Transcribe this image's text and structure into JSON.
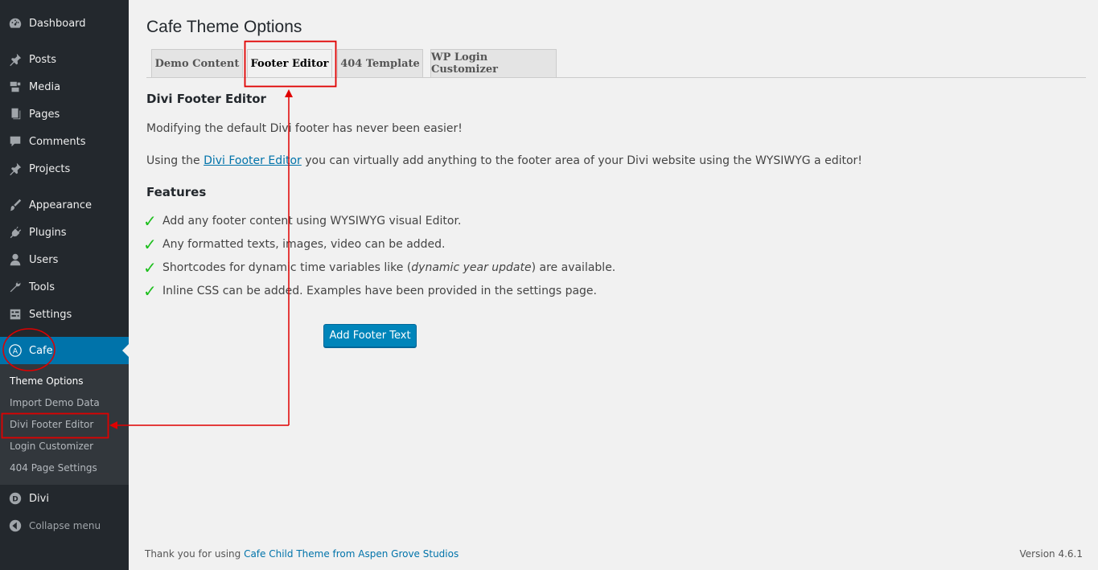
{
  "sidebar": {
    "items": [
      {
        "label": "Dashboard",
        "icon": "dashboard-icon"
      },
      {
        "label": "Posts",
        "icon": "pin-icon"
      },
      {
        "label": "Media",
        "icon": "media-icon"
      },
      {
        "label": "Pages",
        "icon": "pages-icon"
      },
      {
        "label": "Comments",
        "icon": "comment-icon"
      },
      {
        "label": "Projects",
        "icon": "pin-icon"
      },
      {
        "label": "Appearance",
        "icon": "brush-icon"
      },
      {
        "label": "Plugins",
        "icon": "plugin-icon"
      },
      {
        "label": "Users",
        "icon": "user-icon"
      },
      {
        "label": "Tools",
        "icon": "wrench-icon"
      },
      {
        "label": "Settings",
        "icon": "settings-icon"
      },
      {
        "label": "Cafe",
        "icon": "circle-a-icon",
        "active": true
      },
      {
        "label": "Divi",
        "icon": "divi-icon"
      }
    ],
    "submenu": [
      {
        "label": "Theme Options",
        "current": true
      },
      {
        "label": "Import Demo Data"
      },
      {
        "label": "Divi Footer Editor"
      },
      {
        "label": "Login Customizer"
      },
      {
        "label": "404 Page Settings"
      }
    ],
    "collapse_label": "Collapse menu"
  },
  "page": {
    "title": "Cafe Theme Options",
    "tabs": [
      {
        "label": "Demo Content"
      },
      {
        "label": "Footer Editor",
        "active": true
      },
      {
        "label": "404 Template"
      },
      {
        "label": "WP Login Customizer"
      }
    ],
    "section_title": "Divi Footer Editor",
    "intro": "Modifying the default Divi footer has never been easier!",
    "using_prefix": "Using the ",
    "using_link": "Divi Footer Editor",
    "using_suffix": " you can virtually add anything to the footer area of your Divi website using the WYSIWYG a editor!",
    "features_title": "Features",
    "features": [
      "Add any footer content using WYSIWYG visual Editor.",
      "Any formatted texts, images, video can be added.",
      "Inline CSS can be added. Examples have been provided in the settings page."
    ],
    "feature_shortcode": {
      "prefix": "Shortcodes for dynamic time variables like (",
      "emphasis": "dynamic year update",
      "suffix": ") are available."
    },
    "button_label": "Add Footer Text"
  },
  "footer": {
    "thanks_prefix": "Thank you for using ",
    "thanks_link": "Cafe Child Theme from Aspen Grove Studios",
    "version": "Version 4.6.1"
  },
  "colors": {
    "sidebar_bg": "#23282d",
    "active_blue": "#0073aa",
    "button_blue": "#0085ba",
    "annotation_red": "#e00000",
    "check_green": "#1dbf1d"
  }
}
